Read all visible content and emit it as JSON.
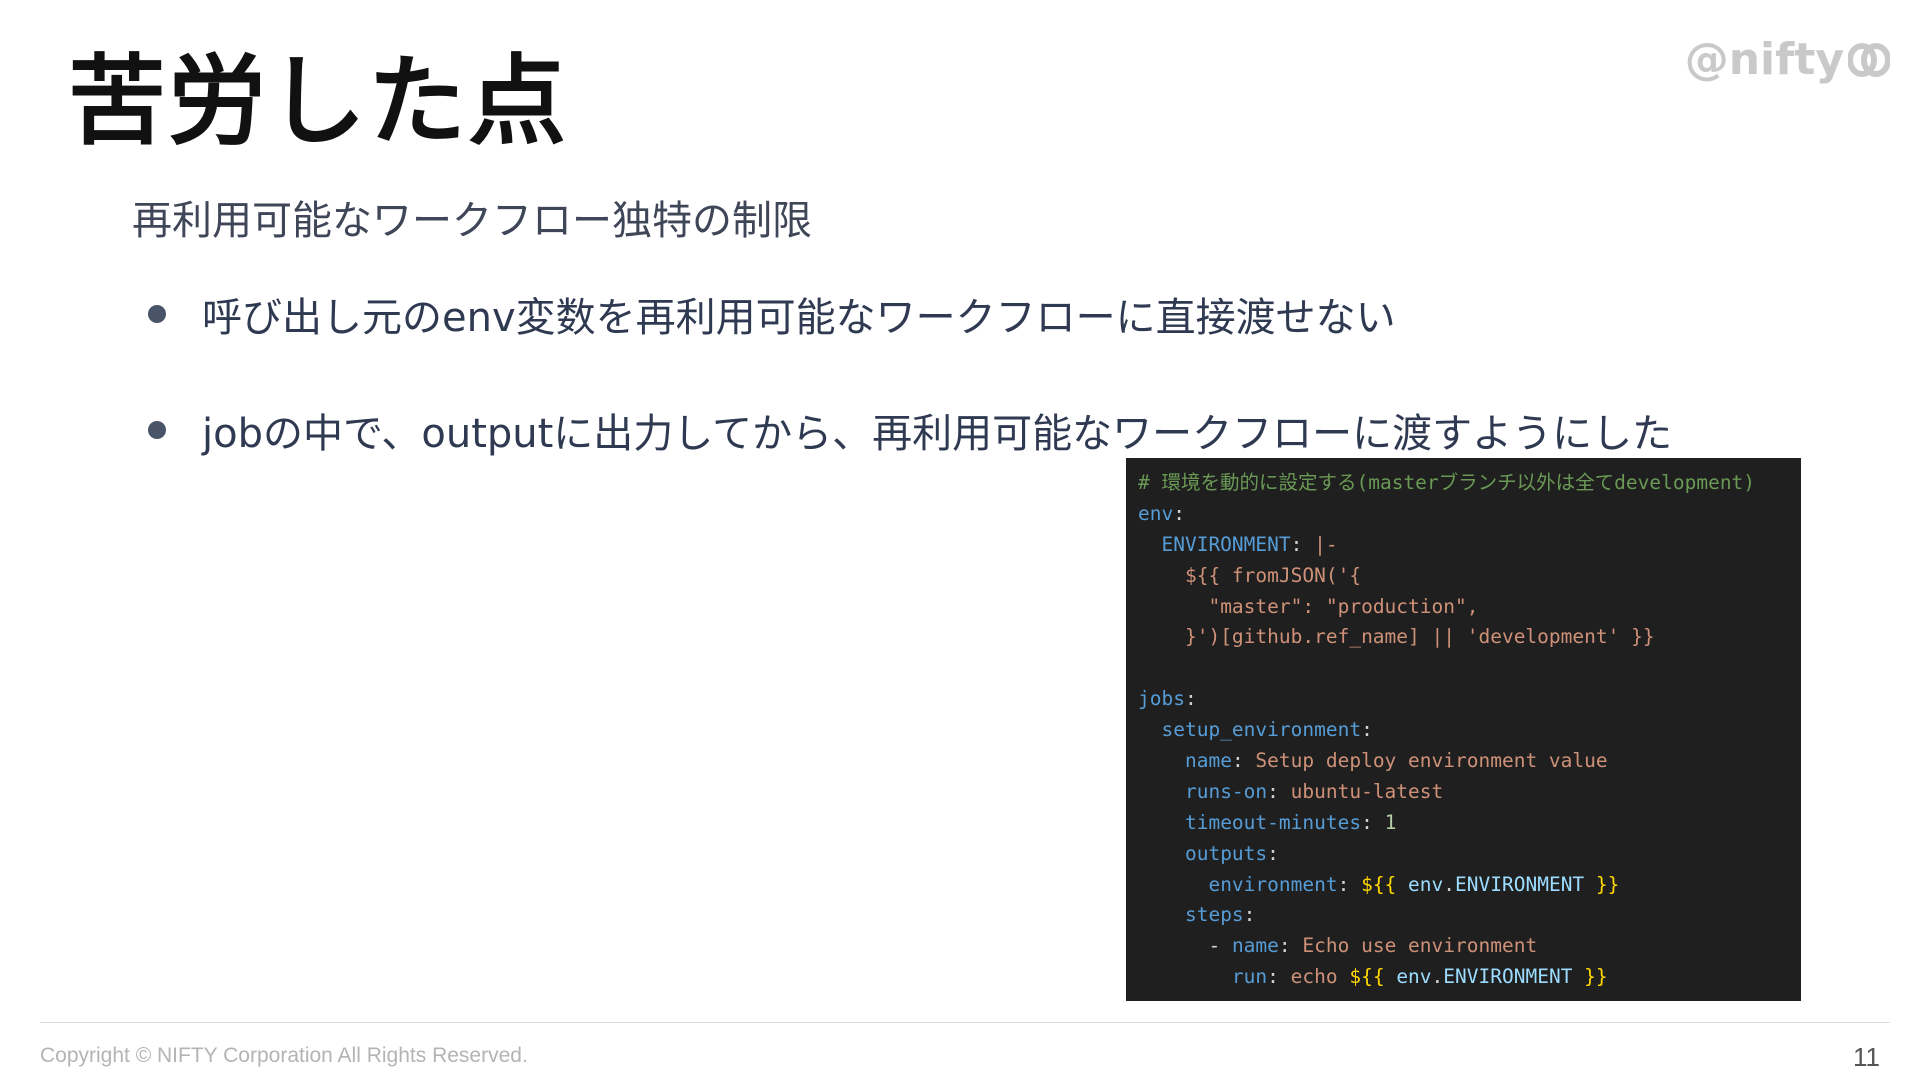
{
  "slide": {
    "title": "苦労した点",
    "subtitle": "再利用可能なワークフロー独特の制限",
    "bullets": [
      "呼び出し元のenv変数を再利用可能なワークフローに直接渡せない",
      "jobの中で、outputに出力してから、再利用可能なワークフローに渡すようにした"
    ],
    "logo_text": "@nifty",
    "logo_icon": "nifty-swirl-icon"
  },
  "code": {
    "lines": [
      {
        "t": "# 環境を動的に設定する(masterブランチ以外は全てdevelopment)"
      },
      {
        "k": "env",
        "p": ":"
      },
      {
        "indent": "  ",
        "k": "ENVIRONMENT",
        "p": ": ",
        "v": "|-"
      },
      {
        "indent": "    ",
        "v": "${{ fromJSON('{"
      },
      {
        "indent": "      ",
        "v": "\"master\": \"production\","
      },
      {
        "indent": "    ",
        "v": "}')[github.ref_name] || 'development' }}"
      },
      {
        "blank": " "
      },
      {
        "k": "jobs",
        "p": ":"
      },
      {
        "indent": "  ",
        "k": "setup_environment",
        "p": ":"
      },
      {
        "indent": "    ",
        "k": "name",
        "p": ": ",
        "v": "Setup deploy environment value"
      },
      {
        "indent": "    ",
        "k": "runs-on",
        "p": ": ",
        "v": "ubuntu-latest"
      },
      {
        "indent": "    ",
        "k": "timeout-minutes",
        "p": ": ",
        "n": "1"
      },
      {
        "indent": "    ",
        "k": "outputs",
        "p": ":"
      },
      {
        "indent": "      ",
        "k": "environment",
        "p": ": ",
        "b1": "${{",
        "var": " env",
        "dot": ".",
        "c": "ENVIRONMENT",
        "b2": " }}"
      },
      {
        "indent": "    ",
        "k": "steps",
        "p": ":"
      },
      {
        "indent": "      ",
        "dash": "- ",
        "k": "name",
        "p": ": ",
        "v": "Echo use environment"
      },
      {
        "indent": "        ",
        "k": "run",
        "p": ": ",
        "v": "echo ",
        "b1": "${{",
        "var": " env",
        "dot": ".",
        "c": "ENVIRONMENT",
        "b2": " }}"
      }
    ]
  },
  "footer": {
    "copyright": "Copyright © NIFTY Corporation All Rights Reserved.",
    "page": "11"
  },
  "colors": {
    "title": "#111111",
    "text": "#2f3a52",
    "code_bg": "#1f1f1f",
    "logo": "#c9c9c9"
  }
}
